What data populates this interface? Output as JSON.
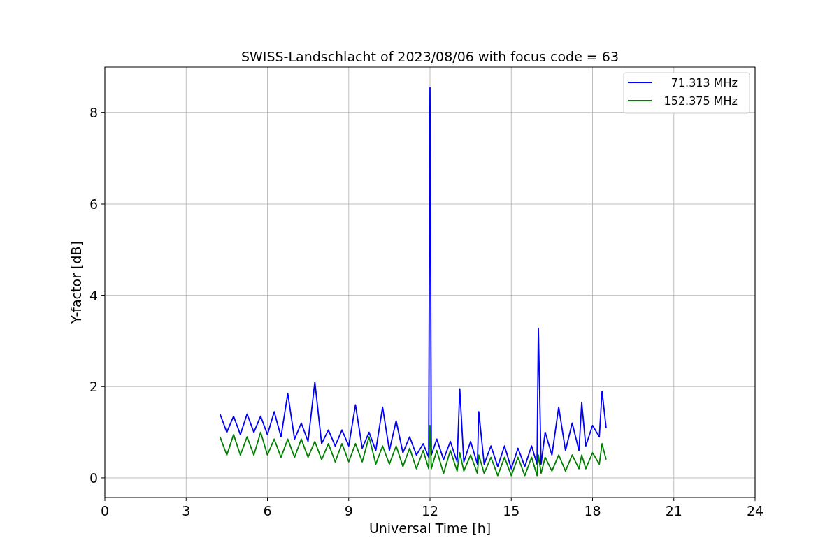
{
  "figure": {
    "chart_data": {
      "type": "line",
      "title": "SWISS-Landschlacht of 2023/08/06 with focus code = 63",
      "xlabel": "Universal Time [h]",
      "ylabel": "Y-factor [dB]",
      "x": [
        4.25,
        4.5,
        4.75,
        5,
        5.25,
        5.5,
        5.75,
        6,
        6.25,
        6.5,
        6.75,
        7,
        7.25,
        7.5,
        7.75,
        8,
        8.25,
        8.5,
        8.75,
        9,
        9.25,
        9.5,
        9.75,
        10,
        10.25,
        10.5,
        10.75,
        11,
        11.25,
        11.5,
        11.75,
        11.95,
        12,
        12.05,
        12.25,
        12.5,
        12.75,
        13,
        13.1,
        13.25,
        13.5,
        13.75,
        13.8,
        14,
        14.25,
        14.5,
        14.75,
        15,
        15.25,
        15.5,
        15.75,
        15.95,
        16,
        16.1,
        16.25,
        16.5,
        16.75,
        17,
        17.25,
        17.5,
        17.6,
        17.75,
        18,
        18.25,
        18.35,
        18.5
      ],
      "series": [
        {
          "name": "71.313 MHz",
          "color": "#0000ff",
          "values": [
            1.4,
            1.0,
            1.35,
            0.95,
            1.4,
            1.0,
            1.35,
            0.95,
            1.45,
            0.9,
            1.85,
            0.85,
            1.2,
            0.8,
            2.1,
            0.75,
            1.05,
            0.7,
            1.05,
            0.7,
            1.6,
            0.65,
            1.0,
            0.6,
            1.55,
            0.6,
            1.25,
            0.55,
            0.9,
            0.5,
            0.75,
            0.45,
            8.55,
            0.5,
            0.85,
            0.4,
            0.8,
            0.35,
            1.95,
            0.35,
            0.8,
            0.3,
            1.45,
            0.3,
            0.7,
            0.25,
            0.7,
            0.2,
            0.65,
            0.25,
            0.7,
            0.3,
            3.28,
            0.3,
            1.0,
            0.5,
            1.55,
            0.6,
            1.2,
            0.6,
            1.65,
            0.7,
            1.15,
            0.9,
            1.9,
            1.1
          ]
        },
        {
          "name": "152.375 MHz",
          "color": "#008000",
          "values": [
            0.9,
            0.5,
            0.95,
            0.5,
            0.9,
            0.5,
            1.0,
            0.5,
            0.85,
            0.45,
            0.85,
            0.45,
            0.85,
            0.45,
            0.8,
            0.4,
            0.75,
            0.35,
            0.75,
            0.35,
            0.75,
            0.35,
            0.9,
            0.3,
            0.7,
            0.3,
            0.7,
            0.25,
            0.65,
            0.2,
            0.6,
            0.2,
            1.15,
            0.2,
            0.6,
            0.1,
            0.6,
            0.15,
            0.55,
            0.15,
            0.5,
            0.1,
            0.5,
            0.1,
            0.45,
            0.05,
            0.45,
            0.05,
            0.45,
            0.05,
            0.45,
            0.05,
            0.5,
            0.1,
            0.45,
            0.15,
            0.5,
            0.15,
            0.5,
            0.2,
            0.5,
            0.2,
            0.55,
            0.3,
            0.75,
            0.4
          ]
        }
      ],
      "xlim": [
        0,
        24
      ],
      "ylim": [
        -0.43,
        9
      ],
      "xticks": [
        0,
        3,
        6,
        9,
        12,
        15,
        18,
        21,
        24
      ],
      "yticks": [
        0,
        2,
        4,
        6,
        8
      ],
      "grid": true,
      "legend": true
    }
  }
}
